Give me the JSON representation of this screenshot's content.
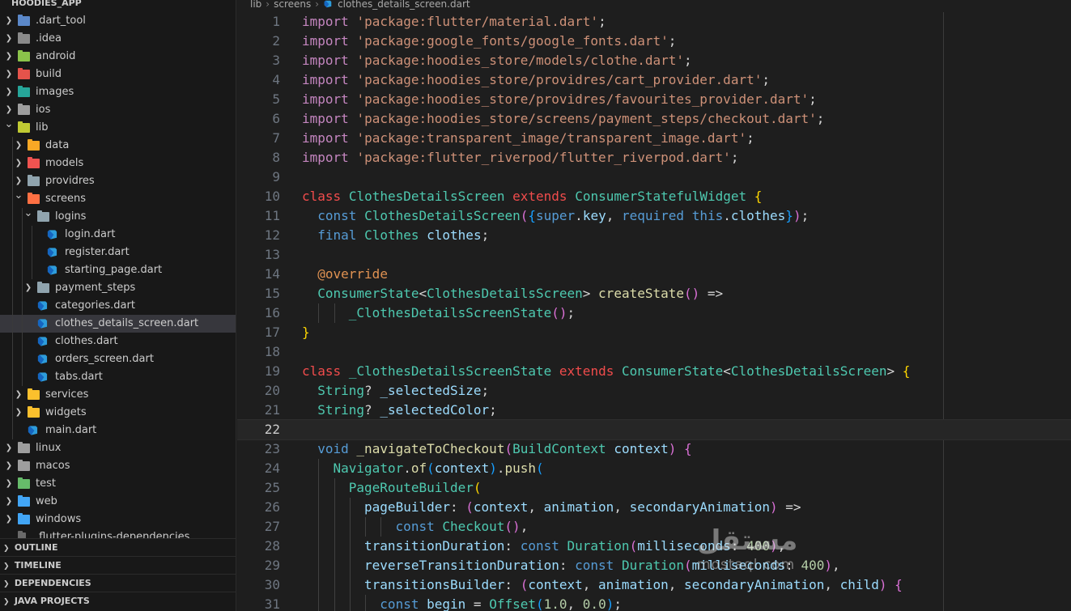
{
  "explorer": {
    "title": "HOODIES_APP",
    "items": [
      {
        "label": ".dart_tool",
        "depth": 0,
        "expanded": false,
        "kind": "folder",
        "color": "#5b88c9"
      },
      {
        "label": ".idea",
        "depth": 0,
        "expanded": false,
        "kind": "folder",
        "color": "#8a8a8a"
      },
      {
        "label": "android",
        "depth": 0,
        "expanded": false,
        "kind": "folder",
        "color": "#8bc34a"
      },
      {
        "label": "build",
        "depth": 0,
        "expanded": false,
        "kind": "folder",
        "color": "#e5534b"
      },
      {
        "label": "images",
        "depth": 0,
        "expanded": false,
        "kind": "folder",
        "color": "#26a69a"
      },
      {
        "label": "ios",
        "depth": 0,
        "expanded": false,
        "kind": "folder",
        "color": "#9e9e9e"
      },
      {
        "label": "lib",
        "depth": 0,
        "expanded": true,
        "kind": "folder",
        "color": "#c0ca33"
      },
      {
        "label": "data",
        "depth": 1,
        "expanded": false,
        "kind": "folder",
        "color": "#f9a825"
      },
      {
        "label": "models",
        "depth": 1,
        "expanded": false,
        "kind": "folder",
        "color": "#ef5350"
      },
      {
        "label": "providres",
        "depth": 1,
        "expanded": false,
        "kind": "folder",
        "color": "#90a4ae"
      },
      {
        "label": "screens",
        "depth": 1,
        "expanded": true,
        "kind": "folder",
        "color": "#ff7043"
      },
      {
        "label": "logins",
        "depth": 2,
        "expanded": true,
        "kind": "folder",
        "color": "#90a4ae"
      },
      {
        "label": "login.dart",
        "depth": 3,
        "kind": "dart"
      },
      {
        "label": "register.dart",
        "depth": 3,
        "kind": "dart"
      },
      {
        "label": "starting_page.dart",
        "depth": 3,
        "kind": "dart"
      },
      {
        "label": "payment_steps",
        "depth": 2,
        "expanded": false,
        "kind": "folder",
        "color": "#90a4ae"
      },
      {
        "label": "categories.dart",
        "depth": 2,
        "kind": "dart"
      },
      {
        "label": "clothes_details_screen.dart",
        "depth": 2,
        "kind": "dart",
        "selected": true
      },
      {
        "label": "clothes.dart",
        "depth": 2,
        "kind": "dart"
      },
      {
        "label": "orders_screen.dart",
        "depth": 2,
        "kind": "dart"
      },
      {
        "label": "tabs.dart",
        "depth": 2,
        "kind": "dart"
      },
      {
        "label": "services",
        "depth": 1,
        "expanded": false,
        "kind": "folder",
        "color": "#fbc02d"
      },
      {
        "label": "widgets",
        "depth": 1,
        "expanded": false,
        "kind": "folder",
        "color": "#fbc02d"
      },
      {
        "label": "main.dart",
        "depth": 1,
        "kind": "dart"
      },
      {
        "label": "linux",
        "depth": 0,
        "expanded": false,
        "kind": "folder",
        "color": "#9e9e9e"
      },
      {
        "label": "macos",
        "depth": 0,
        "expanded": false,
        "kind": "folder",
        "color": "#9e9e9e"
      },
      {
        "label": "test",
        "depth": 0,
        "expanded": false,
        "kind": "folder",
        "color": "#66bb6a"
      },
      {
        "label": "web",
        "depth": 0,
        "expanded": false,
        "kind": "folder",
        "color": "#42a5f5"
      },
      {
        "label": "windows",
        "depth": 0,
        "expanded": false,
        "kind": "folder",
        "color": "#42a5f5"
      },
      {
        "label": ".flutter-plugins-dependencies",
        "depth": 0,
        "kind": "file"
      }
    ]
  },
  "panels": {
    "outline": "OUTLINE",
    "timeline": "TIMELINE",
    "dependencies": "DEPENDENCIES",
    "java_projects": "JAVA PROJECTS"
  },
  "breadcrumb": {
    "segments": [
      "lib",
      "screens",
      "clothes_details_screen.dart"
    ]
  },
  "editor": {
    "current_line": 22,
    "lines": [
      {
        "n": "1",
        "indent": 0,
        "tokens": [
          [
            "kw",
            "import"
          ],
          [
            "pln",
            " "
          ],
          [
            "str",
            "'package:flutter/material.dart'"
          ],
          [
            "pln",
            ";"
          ]
        ]
      },
      {
        "n": "2",
        "indent": 0,
        "tokens": [
          [
            "kw",
            "import"
          ],
          [
            "pln",
            " "
          ],
          [
            "str",
            "'package:google_fonts/google_fonts.dart'"
          ],
          [
            "pln",
            ";"
          ]
        ]
      },
      {
        "n": "3",
        "indent": 0,
        "tokens": [
          [
            "kw",
            "import"
          ],
          [
            "pln",
            " "
          ],
          [
            "str",
            "'package:hoodies_store/models/clothe.dart'"
          ],
          [
            "pln",
            ";"
          ]
        ]
      },
      {
        "n": "4",
        "indent": 0,
        "tokens": [
          [
            "kw",
            "import"
          ],
          [
            "pln",
            " "
          ],
          [
            "str",
            "'package:hoodies_store/providres/cart_provider.dart'"
          ],
          [
            "pln",
            ";"
          ]
        ]
      },
      {
        "n": "5",
        "indent": 0,
        "tokens": [
          [
            "kw",
            "import"
          ],
          [
            "pln",
            " "
          ],
          [
            "str",
            "'package:hoodies_store/providres/favourites_provider.dart'"
          ],
          [
            "pln",
            ";"
          ]
        ]
      },
      {
        "n": "6",
        "indent": 0,
        "tokens": [
          [
            "kw",
            "import"
          ],
          [
            "pln",
            " "
          ],
          [
            "str",
            "'package:hoodies_store/screens/payment_steps/checkout.dart'"
          ],
          [
            "pln",
            ";"
          ]
        ]
      },
      {
        "n": "7",
        "indent": 0,
        "tokens": [
          [
            "kw",
            "import"
          ],
          [
            "pln",
            " "
          ],
          [
            "str",
            "'package:transparent_image/transparent_image.dart'"
          ],
          [
            "pln",
            ";"
          ]
        ]
      },
      {
        "n": "8",
        "indent": 0,
        "tokens": [
          [
            "kw",
            "import"
          ],
          [
            "pln",
            " "
          ],
          [
            "str",
            "'package:flutter_riverpod/flutter_riverpod.dart'"
          ],
          [
            "pln",
            ";"
          ]
        ]
      },
      {
        "n": "9",
        "indent": 0,
        "tokens": []
      },
      {
        "n": "10",
        "indent": 0,
        "tokens": [
          [
            "red",
            "class"
          ],
          [
            "pln",
            " "
          ],
          [
            "cls",
            "ClothesDetailsScreen"
          ],
          [
            "pln",
            " "
          ],
          [
            "red",
            "extends"
          ],
          [
            "pln",
            " "
          ],
          [
            "cls",
            "ConsumerStatefulWidget"
          ],
          [
            "pln",
            " "
          ],
          [
            "b1",
            "{"
          ]
        ]
      },
      {
        "n": "11",
        "indent": 1,
        "tokens": [
          [
            "kw2",
            "const"
          ],
          [
            "pln",
            " "
          ],
          [
            "cls",
            "ClothesDetailsScreen"
          ],
          [
            "b2",
            "("
          ],
          [
            "b3",
            "{"
          ],
          [
            "kw2",
            "super"
          ],
          [
            "pln",
            "."
          ],
          [
            "var",
            "key"
          ],
          [
            "pln",
            ", "
          ],
          [
            "kw2",
            "required"
          ],
          [
            "pln",
            " "
          ],
          [
            "kw2",
            "this"
          ],
          [
            "pln",
            "."
          ],
          [
            "var",
            "clothes"
          ],
          [
            "b3",
            "}"
          ],
          [
            "b2",
            ")"
          ],
          [
            "pln",
            ";"
          ]
        ]
      },
      {
        "n": "12",
        "indent": 1,
        "tokens": [
          [
            "kw2",
            "final"
          ],
          [
            "pln",
            " "
          ],
          [
            "cls",
            "Clothes"
          ],
          [
            "pln",
            " "
          ],
          [
            "var",
            "clothes"
          ],
          [
            "pln",
            ";"
          ]
        ]
      },
      {
        "n": "13",
        "indent": 1,
        "tokens": []
      },
      {
        "n": "14",
        "indent": 1,
        "tokens": [
          [
            "ann",
            "@override"
          ]
        ]
      },
      {
        "n": "15",
        "indent": 1,
        "tokens": [
          [
            "cls",
            "ConsumerState"
          ],
          [
            "pln",
            "<"
          ],
          [
            "cls",
            "ClothesDetailsScreen"
          ],
          [
            "pln",
            "> "
          ],
          [
            "fn",
            "createState"
          ],
          [
            "b2",
            "()"
          ],
          [
            "pln",
            " =>"
          ]
        ]
      },
      {
        "n": "16",
        "indent": 3,
        "tokens": [
          [
            "cls",
            "_ClothesDetailsScreenState"
          ],
          [
            "b2",
            "()"
          ],
          [
            "pln",
            ";"
          ]
        ]
      },
      {
        "n": "17",
        "indent": 0,
        "tokens": [
          [
            "b1",
            "}"
          ]
        ]
      },
      {
        "n": "18",
        "indent": 0,
        "tokens": []
      },
      {
        "n": "19",
        "indent": 0,
        "tokens": [
          [
            "red",
            "class"
          ],
          [
            "pln",
            " "
          ],
          [
            "cls",
            "_ClothesDetailsScreenState"
          ],
          [
            "pln",
            " "
          ],
          [
            "red",
            "extends"
          ],
          [
            "pln",
            " "
          ],
          [
            "cls",
            "ConsumerState"
          ],
          [
            "pln",
            "<"
          ],
          [
            "cls",
            "ClothesDetailsScreen"
          ],
          [
            "pln",
            "> "
          ],
          [
            "b1",
            "{"
          ]
        ]
      },
      {
        "n": "20",
        "indent": 1,
        "tokens": [
          [
            "cls",
            "String"
          ],
          [
            "pln",
            "? "
          ],
          [
            "var",
            "_selectedSize"
          ],
          [
            "pln",
            ";"
          ]
        ]
      },
      {
        "n": "21",
        "indent": 1,
        "tokens": [
          [
            "cls",
            "String"
          ],
          [
            "pln",
            "? "
          ],
          [
            "var",
            "_selectedColor"
          ],
          [
            "pln",
            ";"
          ]
        ]
      },
      {
        "n": "22",
        "indent": 1,
        "tokens": []
      },
      {
        "n": "23",
        "indent": 1,
        "tokens": [
          [
            "kw2",
            "void"
          ],
          [
            "pln",
            " "
          ],
          [
            "fn",
            "_navigateToCheckout"
          ],
          [
            "b2",
            "("
          ],
          [
            "cls",
            "BuildContext"
          ],
          [
            "pln",
            " "
          ],
          [
            "var",
            "context"
          ],
          [
            "b2",
            ")"
          ],
          [
            "pln",
            " "
          ],
          [
            "b2",
            "{"
          ]
        ]
      },
      {
        "n": "24",
        "indent": 2,
        "tokens": [
          [
            "cls",
            "Navigator"
          ],
          [
            "pln",
            "."
          ],
          [
            "fn",
            "of"
          ],
          [
            "b3",
            "("
          ],
          [
            "var",
            "context"
          ],
          [
            "b3",
            ")"
          ],
          [
            "pln",
            "."
          ],
          [
            "fn",
            "push"
          ],
          [
            "b3",
            "("
          ]
        ]
      },
      {
        "n": "25",
        "indent": 3,
        "tokens": [
          [
            "cls",
            "PageRouteBuilder"
          ],
          [
            "b1",
            "("
          ]
        ]
      },
      {
        "n": "26",
        "indent": 4,
        "tokens": [
          [
            "var",
            "pageBuilder"
          ],
          [
            "pln",
            ": "
          ],
          [
            "b2",
            "("
          ],
          [
            "var",
            "context"
          ],
          [
            "pln",
            ", "
          ],
          [
            "var",
            "animation"
          ],
          [
            "pln",
            ", "
          ],
          [
            "var",
            "secondaryAnimation"
          ],
          [
            "b2",
            ")"
          ],
          [
            "pln",
            " =>"
          ]
        ]
      },
      {
        "n": "27",
        "indent": 6,
        "tokens": [
          [
            "kw2",
            "const"
          ],
          [
            "pln",
            " "
          ],
          [
            "cls",
            "Checkout"
          ],
          [
            "b2",
            "()"
          ],
          [
            "pln",
            ","
          ]
        ]
      },
      {
        "n": "28",
        "indent": 4,
        "tokens": [
          [
            "var",
            "transitionDuration"
          ],
          [
            "pln",
            ": "
          ],
          [
            "kw2",
            "const"
          ],
          [
            "pln",
            " "
          ],
          [
            "cls",
            "Duration"
          ],
          [
            "b2",
            "("
          ],
          [
            "var",
            "milliseconds"
          ],
          [
            "pln",
            ": "
          ],
          [
            "num",
            "400"
          ],
          [
            "b2",
            ")"
          ],
          [
            "pln",
            ","
          ]
        ]
      },
      {
        "n": "29",
        "indent": 4,
        "tokens": [
          [
            "var",
            "reverseTransitionDuration"
          ],
          [
            "pln",
            ": "
          ],
          [
            "kw2",
            "const"
          ],
          [
            "pln",
            " "
          ],
          [
            "cls",
            "Duration"
          ],
          [
            "b2",
            "("
          ],
          [
            "var",
            "milliseconds"
          ],
          [
            "pln",
            ": "
          ],
          [
            "num",
            "400"
          ],
          [
            "b2",
            ")"
          ],
          [
            "pln",
            ","
          ]
        ]
      },
      {
        "n": "30",
        "indent": 4,
        "tokens": [
          [
            "var",
            "transitionsBuilder"
          ],
          [
            "pln",
            ": "
          ],
          [
            "b2",
            "("
          ],
          [
            "var",
            "context"
          ],
          [
            "pln",
            ", "
          ],
          [
            "var",
            "animation"
          ],
          [
            "pln",
            ", "
          ],
          [
            "var",
            "secondaryAnimation"
          ],
          [
            "pln",
            ", "
          ],
          [
            "var",
            "child"
          ],
          [
            "b2",
            ")"
          ],
          [
            "pln",
            " "
          ],
          [
            "b2",
            "{"
          ]
        ]
      },
      {
        "n": "31",
        "indent": 5,
        "tokens": [
          [
            "kw2",
            "const"
          ],
          [
            "pln",
            " "
          ],
          [
            "var",
            "begin"
          ],
          [
            "pln",
            " = "
          ],
          [
            "cls",
            "Offset"
          ],
          [
            "b3",
            "("
          ],
          [
            "num",
            "1.0"
          ],
          [
            "pln",
            ", "
          ],
          [
            "num",
            "0.0"
          ],
          [
            "b3",
            ")"
          ],
          [
            "pln",
            ";"
          ]
        ]
      }
    ]
  },
  "watermark": {
    "arabic": "مستقل",
    "latin": "mostaql.com"
  }
}
